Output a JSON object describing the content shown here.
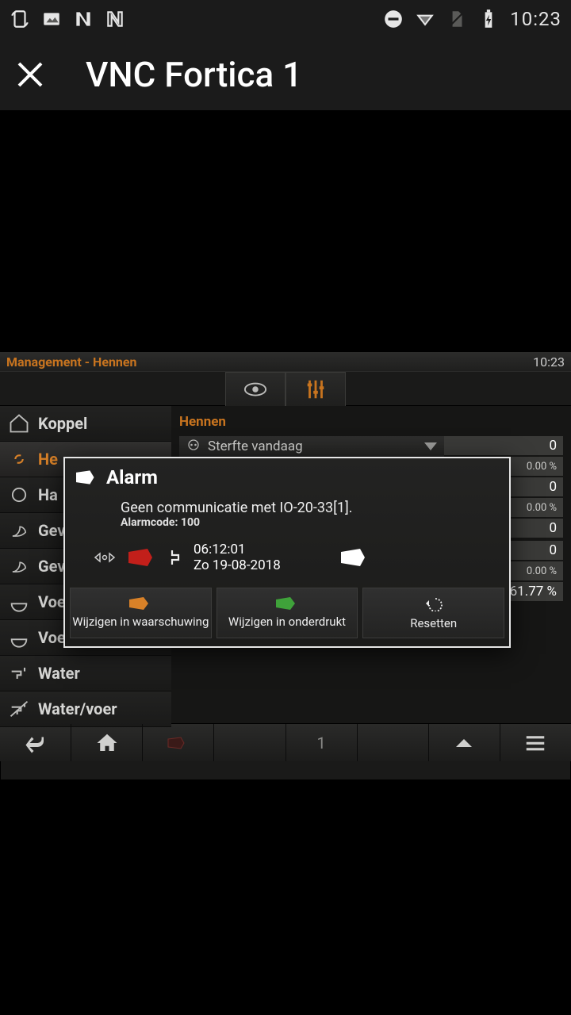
{
  "status_bar": {
    "clock": "10:23"
  },
  "app": {
    "title": "VNC Fortica 1"
  },
  "vnc_header": {
    "breadcrumb": "Management - Hennen",
    "time": "10:23"
  },
  "sidebar": {
    "items": [
      {
        "label": "Koppel"
      },
      {
        "label": "He"
      },
      {
        "label": "Ha"
      },
      {
        "label": "Gev"
      },
      {
        "label": "Gev"
      },
      {
        "label": "Voe"
      },
      {
        "label": "Voe"
      },
      {
        "label": "Water"
      },
      {
        "label": "Water/voer"
      }
    ]
  },
  "content": {
    "title": "Hennen",
    "rows": [
      {
        "label": "Sterfte vandaag",
        "value": "0",
        "sub": "0.00 %"
      },
      {
        "label": "",
        "value": "0",
        "sub": "0.00 %"
      },
      {
        "label": "",
        "value": "0"
      },
      {
        "label": "",
        "value": "0",
        "sub": "0.00 %"
      },
      {
        "label": "",
        "value": "61.77 %"
      }
    ]
  },
  "alarm": {
    "title": "Alarm",
    "message": "Geen communicatie met IO-20-33[1].",
    "code_label": "Alarmcode: 100",
    "time": "06:12:01",
    "date": "Zo 19-08-2018",
    "buttons": {
      "warn": "Wijzigen in waarschuwing",
      "suppress": "Wijzigen in onderdrukt",
      "reset": "Resetten"
    }
  },
  "bottom_nav": {
    "page": "1"
  }
}
